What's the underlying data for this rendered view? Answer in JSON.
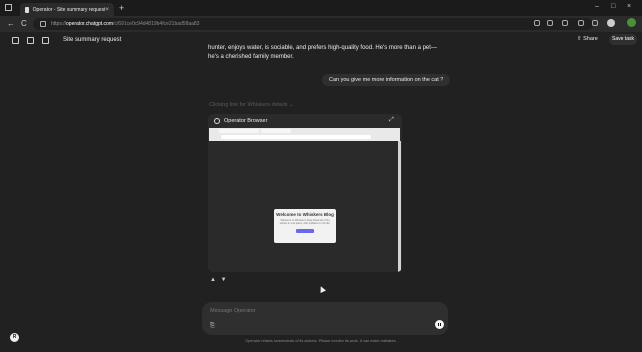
{
  "browser": {
    "tab_title": "Operator - Site summary request",
    "tab_close": "×",
    "new_tab": "+",
    "url_scheme": "https://",
    "url_host": "operator.chatgpt.com",
    "url_path": "/c/691ce0c94d4819b4fce21bad58aa83",
    "win_min": "–",
    "win_max": "□",
    "win_close": "×",
    "back": "←",
    "reload": "C"
  },
  "header": {
    "title": "Site summary request",
    "share_label": "Share",
    "share_icon": "⇧",
    "save_task_label": "Save task"
  },
  "conversation": {
    "assistant_partial": "hunter, enjoys water, is sociable, and prefers high-quality food. He's more than a pet—he's a cherished family member.",
    "user_message": "Can you give me more information on the cat ?",
    "status_line": "Clicking link for Whiskers details ⌄"
  },
  "operator_panel": {
    "title": "Operator Browser",
    "expand_icon": "⤢",
    "modal_title": "Welcome to Whiskers Blog",
    "modal_body": "Welcome to Whiskers' blog! Read all of his stories in one place, with updates on his life."
  },
  "feedback": {
    "thumbs_up": "👍",
    "thumbs_down": "👎"
  },
  "composer": {
    "placeholder": "Message Operator",
    "attach_icon": "📎"
  },
  "footer": {
    "disclaimer": "Operator retains screenshots of its actions. Please monitor its work. It can make mistakes.",
    "avatar_initial": "R"
  }
}
